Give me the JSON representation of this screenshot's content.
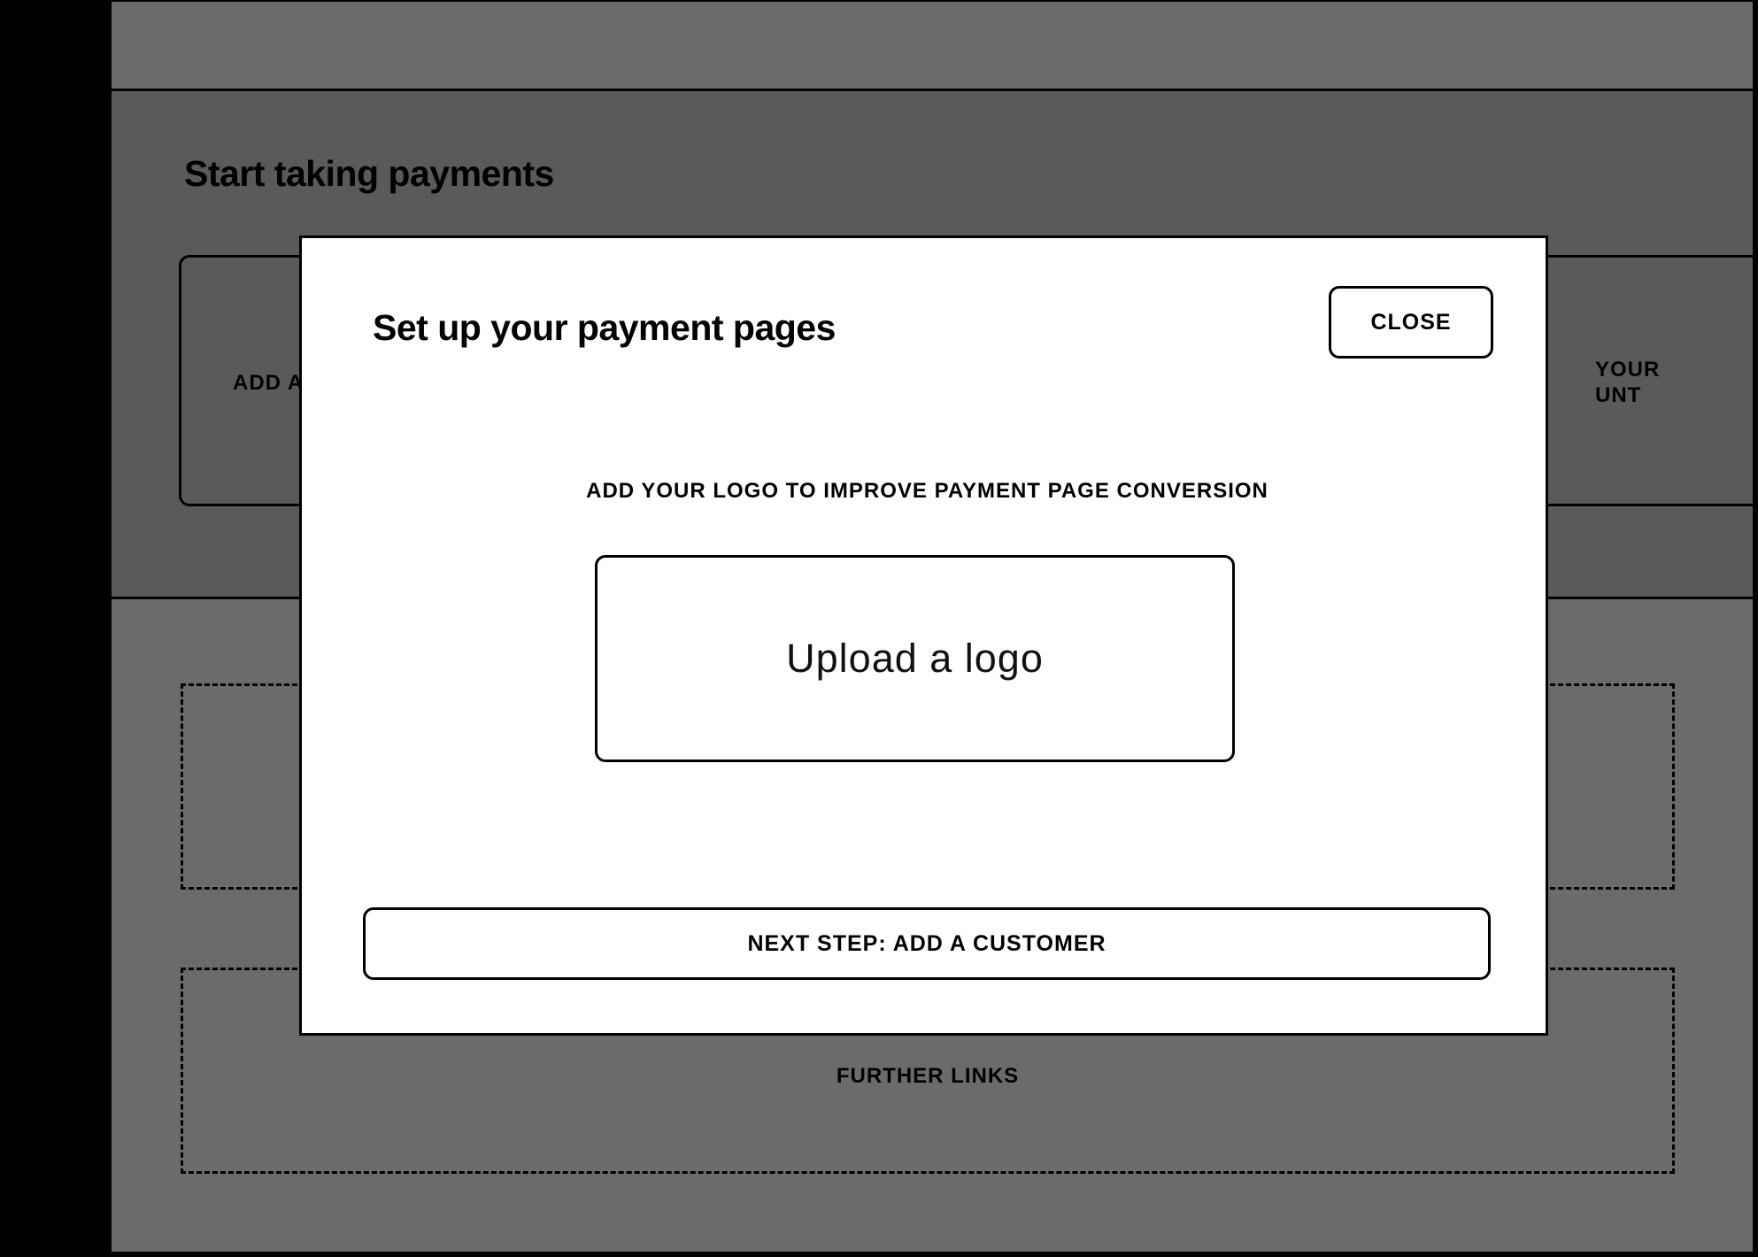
{
  "background": {
    "heading": "Start taking payments",
    "card_left_label": "ADD A",
    "card_right_label_line1": "YOUR",
    "card_right_label_line2": "UNT",
    "further_links_label": "FURTHER LINKS"
  },
  "modal": {
    "title": "Set up your payment pages",
    "close_label": "CLOSE",
    "subtitle": "ADD YOUR LOGO TO IMPROVE PAYMENT PAGE CONVERSION",
    "upload_label": "Upload a logo",
    "next_label": "NEXT STEP: ADD A CUSTOMER"
  }
}
